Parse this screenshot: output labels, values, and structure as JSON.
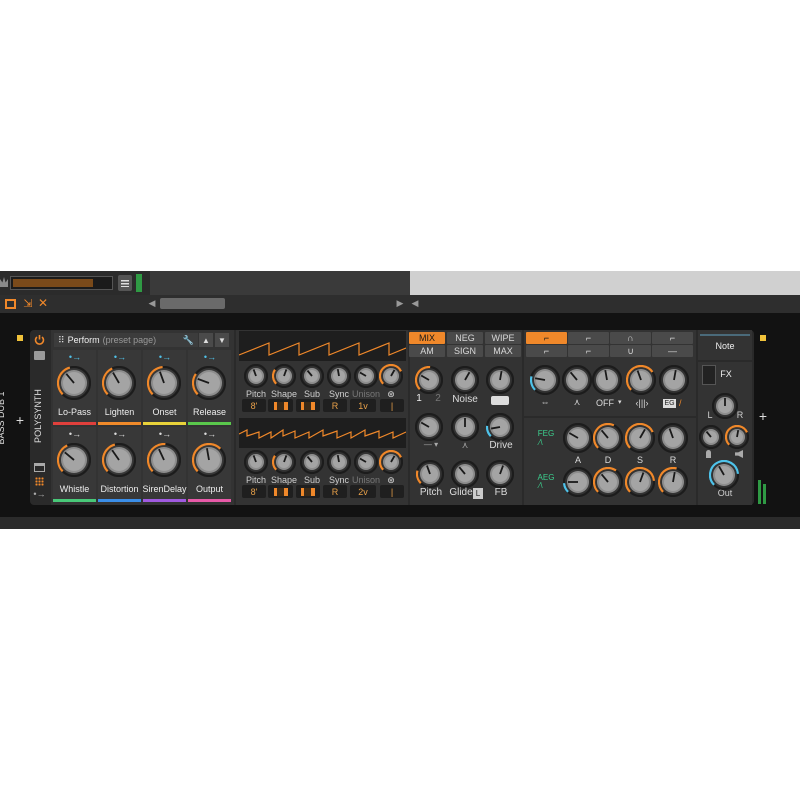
{
  "colors": {
    "accent": "#f0882a",
    "blue": "#4fc3ea",
    "panel": "#3b3b3b",
    "dark": "#1a1a1a",
    "green": "#3ccf8e"
  },
  "track": {
    "name": "BASS DUB 1"
  },
  "device": {
    "name": "POLYSYNTH",
    "preset_page": "Perform",
    "preset_page_hint": "(preset page)"
  },
  "remote_controls": [
    {
      "label": "Lo-Pass",
      "color": "#e0403c"
    },
    {
      "label": "Lighten",
      "color": "#f08a2a"
    },
    {
      "label": "Onset",
      "color": "#e8d23a"
    },
    {
      "label": "Release",
      "color": "#5ac84c"
    },
    {
      "label": "Whistle",
      "color": "#48c878"
    },
    {
      "label": "Distortion",
      "color": "#3b8ee8"
    },
    {
      "label": "SirenDelay",
      "color": "#a05ae0"
    },
    {
      "label": "Output",
      "color": "#e85aa8"
    }
  ],
  "osc1": {
    "knobs": [
      "Pitch",
      "Shape",
      "Sub",
      "Sync",
      "Unison"
    ],
    "values": [
      "8'",
      "",
      "",
      "R",
      "1v"
    ]
  },
  "osc2": {
    "knobs": [
      "Pitch",
      "Shape",
      "Sub",
      "Sync",
      "Unison"
    ],
    "values": [
      "8'",
      "",
      "",
      "R",
      "2v"
    ]
  },
  "mixer": {
    "modes": [
      "MIX",
      "NEG",
      "WIPE",
      "AM",
      "SIGN",
      "MAX"
    ],
    "active_mode": "MIX",
    "osc_nums": [
      "1",
      "2"
    ],
    "noise_label": "Noise",
    "drive_label": "Drive",
    "bottom_labels": [
      "Pitch",
      "Glide",
      "FB"
    ],
    "glide_badge": "L"
  },
  "filter": {
    "off_label": "OFF",
    "eg_label": "EG"
  },
  "envelopes": {
    "feg_label": "FEG",
    "aeg_label": "AEG",
    "adsr": [
      "A",
      "D",
      "S",
      "R"
    ]
  },
  "right": {
    "note_label": "Note",
    "fx_label": "FX",
    "out_label": "Out",
    "pan_l": "L",
    "pan_r": "R"
  }
}
